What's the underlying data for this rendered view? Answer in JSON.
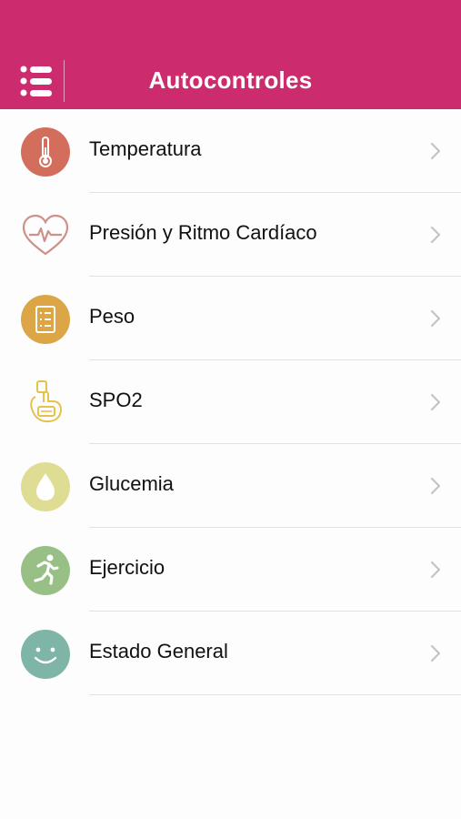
{
  "header": {
    "title": "Autocontroles",
    "menu_icon": "list-menu-icon",
    "background_color": "#cc2b6e"
  },
  "items": [
    {
      "label": "Temperatura",
      "icon": "thermometer-icon",
      "color": "#d46e5c"
    },
    {
      "label": "Presión y Ritmo Cardíaco",
      "icon": "heart-pulse-icon",
      "color": "#cf8f8b"
    },
    {
      "label": "Peso",
      "icon": "checklist-icon",
      "color": "#dca545"
    },
    {
      "label": "SPO2",
      "icon": "pulse-oximeter-icon",
      "color": "#e6c24a"
    },
    {
      "label": "Glucemia",
      "icon": "blood-drop-icon",
      "color": "#dfdc93"
    },
    {
      "label": "Ejercicio",
      "icon": "running-person-icon",
      "color": "#98bf85"
    },
    {
      "label": "Estado General",
      "icon": "smiley-face-icon",
      "color": "#7eb5a6"
    }
  ]
}
